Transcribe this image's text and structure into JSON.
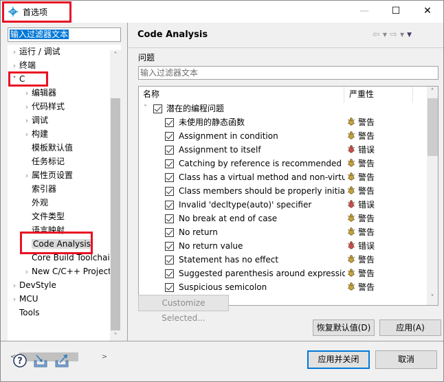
{
  "window": {
    "title": "首选项",
    "minimize_label": "—",
    "maximize_label": "☐",
    "close_label": "✕"
  },
  "left_pane": {
    "filter_text": "输入过滤器文本",
    "tree": [
      {
        "label": "运行 / 调试",
        "level": 0,
        "expandable": true,
        "expanded": false
      },
      {
        "label": "终端",
        "level": 0,
        "expandable": true,
        "expanded": false
      },
      {
        "label": "C",
        "level": 0,
        "expandable": true,
        "expanded": true
      },
      {
        "label": "编辑器",
        "level": 1,
        "expandable": true,
        "expanded": false
      },
      {
        "label": "代码样式",
        "level": 1,
        "expandable": true,
        "expanded": false
      },
      {
        "label": "调试",
        "level": 1,
        "expandable": true,
        "expanded": false
      },
      {
        "label": "构建",
        "level": 1,
        "expandable": true,
        "expanded": false
      },
      {
        "label": "模板默认值",
        "level": 1,
        "expandable": false
      },
      {
        "label": "任务标记",
        "level": 1,
        "expandable": false
      },
      {
        "label": "属性页设置",
        "level": 1,
        "expandable": true,
        "expanded": false
      },
      {
        "label": "索引器",
        "level": 1,
        "expandable": false
      },
      {
        "label": "外观",
        "level": 1,
        "expandable": false
      },
      {
        "label": "文件类型",
        "level": 1,
        "expandable": false
      },
      {
        "label": "语言映射",
        "level": 1,
        "expandable": false
      },
      {
        "label": "Code Analysis",
        "level": 1,
        "expandable": false,
        "selected": true
      },
      {
        "label": "Core Build Toolchains",
        "level": 1,
        "expandable": false
      },
      {
        "label": "New C/C++ Project Wizard",
        "level": 1,
        "expandable": true,
        "expanded": false
      },
      {
        "label": "DevStyle",
        "level": 0,
        "expandable": true,
        "expanded": false
      },
      {
        "label": "MCU",
        "level": 0,
        "expandable": true,
        "expanded": false
      },
      {
        "label": "Tools",
        "level": 0,
        "expandable": false
      }
    ]
  },
  "right_pane": {
    "title": "Code Analysis",
    "section_label": "问题",
    "filter_placeholder": "输入过滤器文本",
    "columns": [
      "名称",
      "严重性"
    ],
    "group": {
      "label": "潜在的编程问题",
      "checked": true,
      "expanded": true
    },
    "problems": [
      {
        "name": "未使用的静态函数",
        "checked": true,
        "severity": "警告",
        "type": "warning"
      },
      {
        "name": "Assignment in condition",
        "checked": true,
        "severity": "警告",
        "type": "warning"
      },
      {
        "name": "Assignment to itself",
        "checked": true,
        "severity": "错误",
        "type": "error"
      },
      {
        "name": "Catching by reference is recommended",
        "checked": true,
        "severity": "警告",
        "type": "warning"
      },
      {
        "name": "Class has a virtual method and non-virtual destructor",
        "checked": true,
        "severity": "警告",
        "type": "warning"
      },
      {
        "name": "Class members should be properly initialized",
        "checked": true,
        "severity": "警告",
        "type": "warning"
      },
      {
        "name": "Invalid 'decltype(auto)' specifier",
        "checked": true,
        "severity": "错误",
        "type": "error"
      },
      {
        "name": "No break at end of case",
        "checked": true,
        "severity": "警告",
        "type": "warning"
      },
      {
        "name": "No return",
        "checked": true,
        "severity": "警告",
        "type": "warning"
      },
      {
        "name": "No return value",
        "checked": true,
        "severity": "错误",
        "type": "error"
      },
      {
        "name": "Statement has no effect",
        "checked": true,
        "severity": "警告",
        "type": "warning"
      },
      {
        "name": "Suggested parenthesis around expression",
        "checked": true,
        "severity": "警告",
        "type": "warning"
      },
      {
        "name": "Suspicious semicolon",
        "checked": true,
        "severity": "警告",
        "type": "warning"
      }
    ],
    "customize_button": "Customize Selected...",
    "restore_defaults_button": "恢复默认值(D)",
    "apply_button": "应用(A)"
  },
  "bottom_bar": {
    "apply_close_button": "应用并关闭",
    "cancel_button": "取消"
  },
  "colors": {
    "highlight_box": "#e81123",
    "selection": "#0078d7",
    "warning_bug": "#c8a23a",
    "error_bug": "#d04a5a"
  }
}
